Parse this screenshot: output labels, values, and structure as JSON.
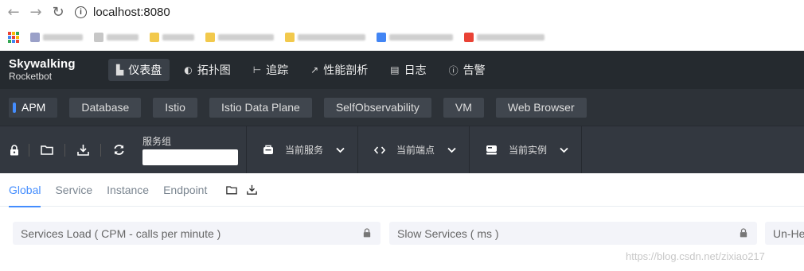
{
  "browser": {
    "url": "localhost:8080",
    "nav": {
      "back": "←",
      "forward": "→",
      "reload": "↻"
    }
  },
  "app": {
    "logo_main": "Skywalking",
    "logo_sub": "Rocketbot",
    "top_nav": [
      {
        "label": "仪表盘",
        "icon": "dashboard-icon",
        "glyph": "▙"
      },
      {
        "label": "拓扑图",
        "icon": "topology-icon",
        "glyph": "◐"
      },
      {
        "label": "追踪",
        "icon": "trace-icon",
        "glyph": "⊢"
      },
      {
        "label": "性能剖析",
        "icon": "profile-icon",
        "glyph": "↗"
      },
      {
        "label": "日志",
        "icon": "log-icon",
        "glyph": "▤"
      },
      {
        "label": "告警",
        "icon": "alarm-icon",
        "glyph": "ⓘ"
      }
    ]
  },
  "layers": [
    "APM",
    "Database",
    "Istio",
    "Istio Data Plane",
    "SelfObservability",
    "VM",
    "Web Browser"
  ],
  "toolbar": {
    "group_label": "服务组",
    "group_value": "",
    "service_label": "当前服务",
    "endpoint_label": "当前端点",
    "instance_label": "当前实例"
  },
  "dash_tabs": [
    "Global",
    "Service",
    "Instance",
    "Endpoint"
  ],
  "cards": [
    {
      "title": "Services Load ( CPM - calls per minute )"
    },
    {
      "title": "Slow Services ( ms )"
    },
    {
      "title": "Un-He"
    }
  ],
  "watermark": "https://blog.csdn.net/zixiao217",
  "colors": {
    "accent": "#448dfe",
    "header_bg": "#252a2f",
    "layer_bg": "#2d3238",
    "toolbar_bg": "#333840"
  }
}
